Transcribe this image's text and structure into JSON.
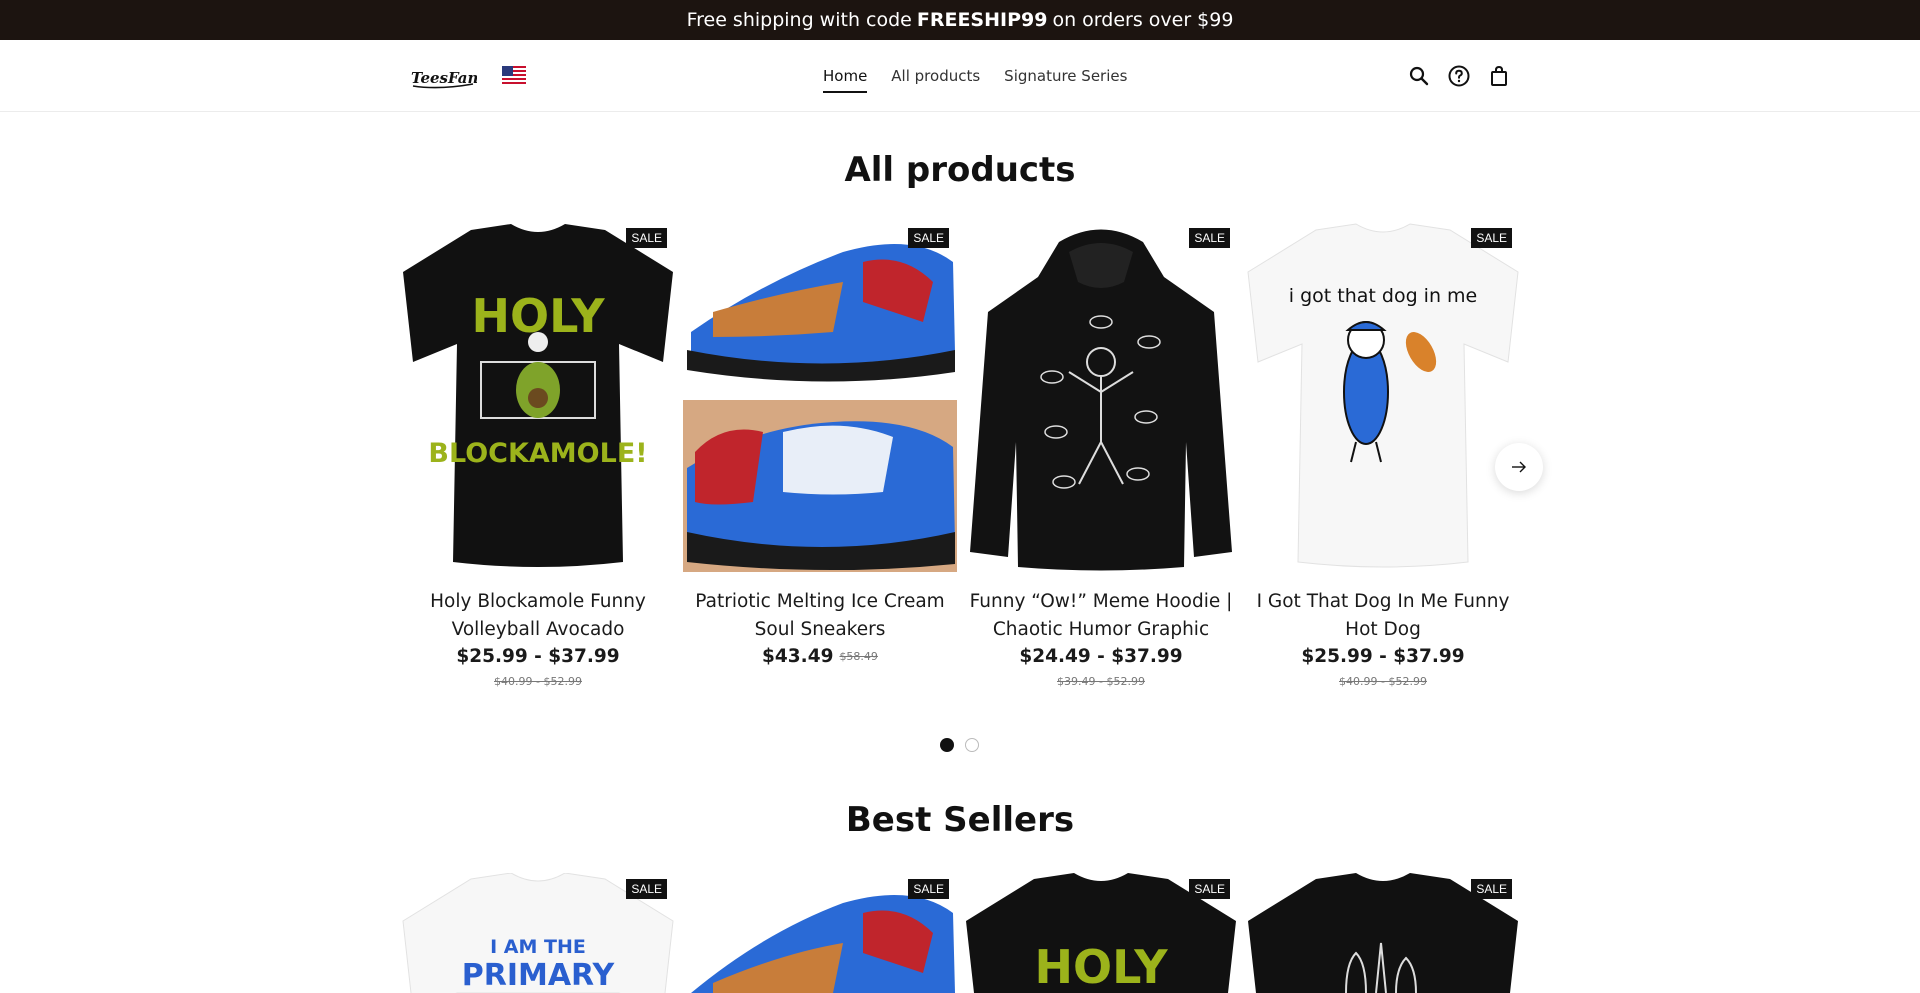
{
  "announcement": {
    "prefix": "Free shipping with code",
    "code": "FREESHIP99",
    "suffix": "on orders over $99"
  },
  "header": {
    "logo_text": "TeesFan",
    "nav": [
      {
        "label": "Home"
      },
      {
        "label": "All products"
      },
      {
        "label": "Signature Series"
      }
    ],
    "icons": [
      "search-icon",
      "help-icon",
      "cart-icon"
    ]
  },
  "all_products": {
    "title": "All products",
    "badge": "SALE",
    "items": [
      {
        "name": "Holy Blockamole Funny Volleyball Avocado",
        "price": "$25.99 - $37.99",
        "compare": "$40.99 - $52.99"
      },
      {
        "name": "Patriotic Melting Ice Cream Soul Sneakers",
        "price": "$43.49",
        "compare": "$58.49"
      },
      {
        "name": "Funny “Ow!” Meme Hoodie | Chaotic Humor Graphic",
        "price": "$24.49 - $37.99",
        "compare": "$39.49 - $52.99"
      },
      {
        "name": "I Got That Dog In Me Funny Hot Dog",
        "price": "$25.99 - $37.99",
        "compare": "$40.99 - $52.99"
      }
    ],
    "pagination": {
      "pages": 2,
      "current": 1
    }
  },
  "best_sellers": {
    "title": "Best Sellers",
    "badge": "SALE",
    "items": [
      {
        "image": "white-tee-primary"
      },
      {
        "image": "sneaker"
      },
      {
        "image": "black-tee-holy"
      },
      {
        "image": "black-tee-veggies"
      }
    ]
  },
  "colors": {
    "announcement_bg": "#1c1410",
    "accent": "#111111",
    "avocado": "#9cb31b"
  }
}
